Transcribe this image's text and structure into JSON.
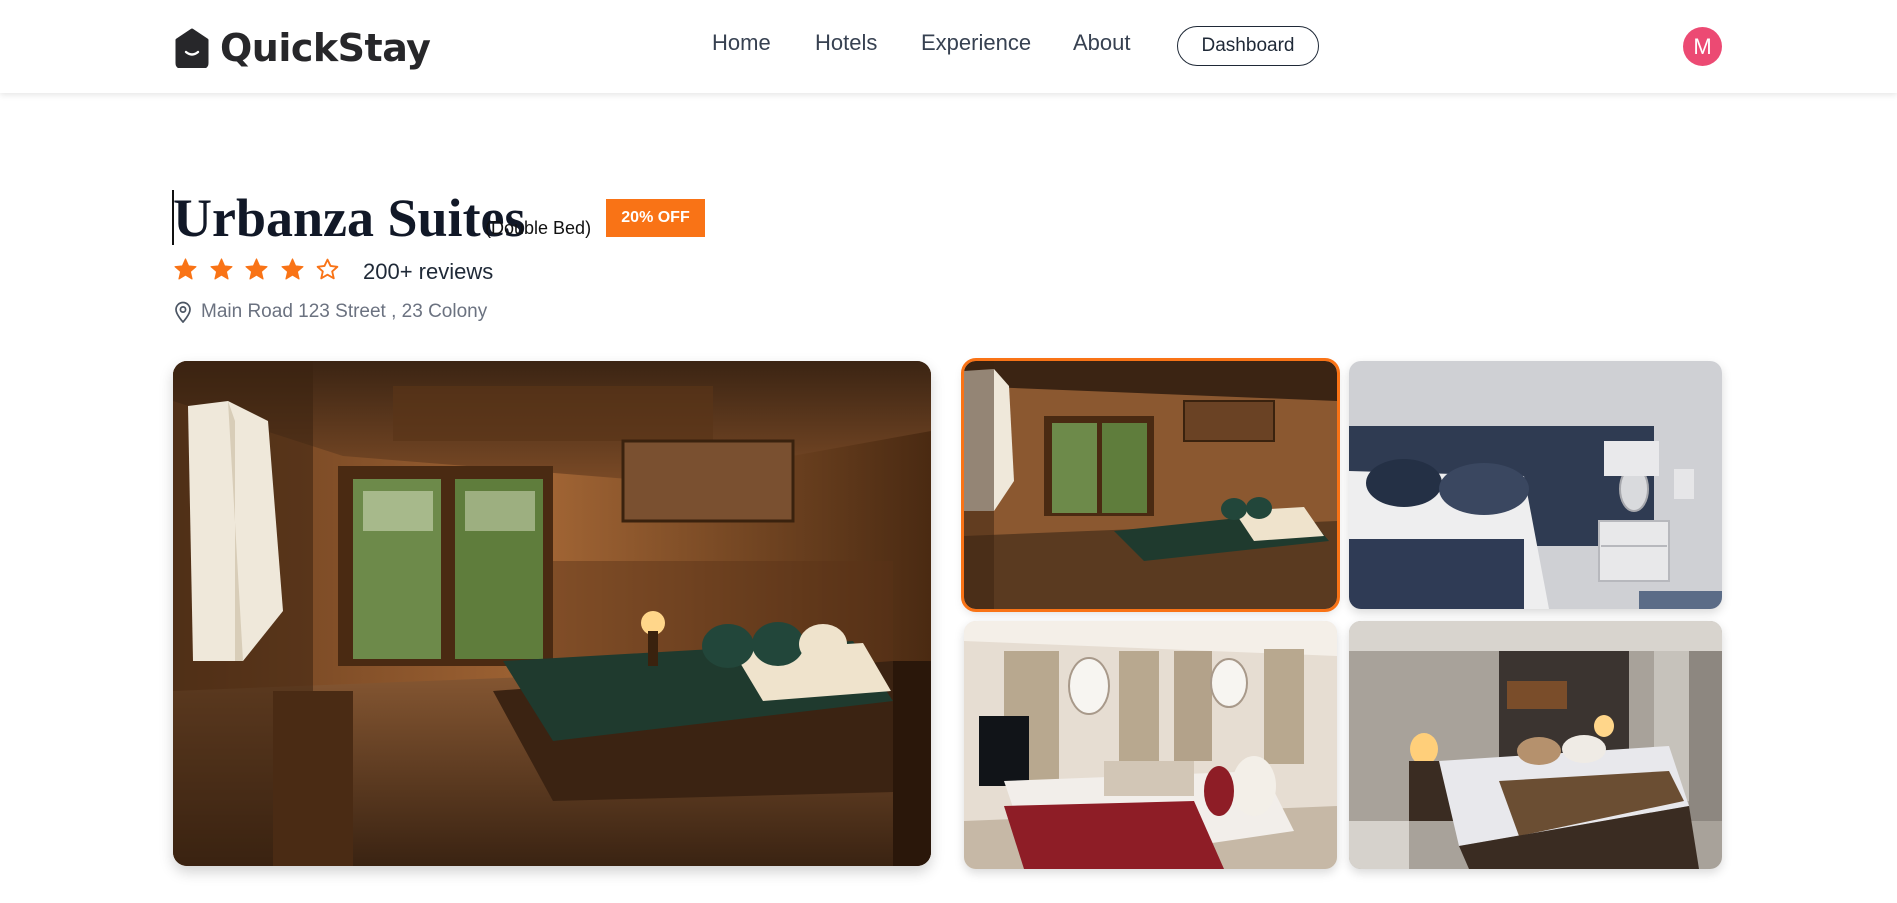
{
  "brand": {
    "name": "QuickStay",
    "logo_icon": "house-smile-icon"
  },
  "nav": {
    "links": [
      "Home",
      "Hotels",
      "Experience",
      "About"
    ],
    "dashboard_label": "Dashboard",
    "avatar_initial": "M"
  },
  "hotel": {
    "name": "Urbanza Suites",
    "room_type": "(Double Bed)",
    "offer": "20% OFF",
    "rating": 4,
    "rating_max": 5,
    "reviews": "200+ reviews",
    "address": "Main Road 123 Street , 23 Colony"
  },
  "gallery": {
    "selected_index": 0,
    "images": [
      "room-wooden-tropical",
      "room-navy-headboard",
      "room-red-throw",
      "room-warm-lamps"
    ]
  },
  "colors": {
    "accent": "#f97316",
    "avatar": "#ec4a73",
    "text": "#1f2937",
    "muted": "#6b7280"
  }
}
